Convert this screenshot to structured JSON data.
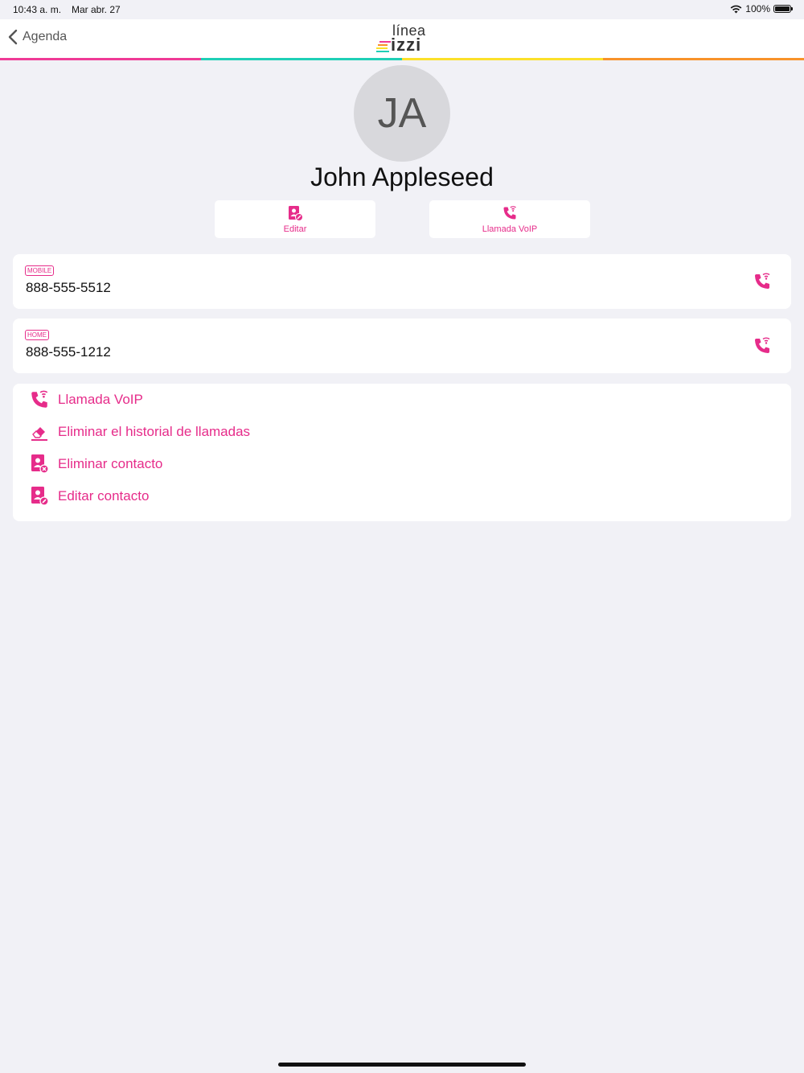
{
  "status_bar": {
    "time": "10:43 a. m.",
    "date": "Mar abr. 27",
    "battery": "100%"
  },
  "nav": {
    "back_label": "Agenda",
    "logo_top": "línea",
    "logo_bottom": "izzi"
  },
  "colors": {
    "accent": "#e62c8a",
    "bar": [
      "#ef3a96",
      "#1fcfb6",
      "#fbe02a",
      "#f8922a"
    ],
    "logo_stripes": [
      "#ef3a96",
      "#f8922a",
      "#fbe02a",
      "#1fcfb6"
    ]
  },
  "contact": {
    "initials": "JA",
    "name": "John Appleseed"
  },
  "actions": {
    "edit_label": "Editar",
    "voip_label": "Llamada VoIP"
  },
  "phones": [
    {
      "type": "MOBILE",
      "number": "888-555-5512"
    },
    {
      "type": "HOME",
      "number": "888-555-1212"
    }
  ],
  "options": [
    {
      "label": "Llamada VoIP",
      "icon": "voip-call-icon"
    },
    {
      "label": "Eliminar el historial de llamadas",
      "icon": "eraser-icon"
    },
    {
      "label": "Eliminar contacto",
      "icon": "delete-contact-icon"
    },
    {
      "label": "Editar contacto",
      "icon": "edit-contact-icon"
    }
  ]
}
